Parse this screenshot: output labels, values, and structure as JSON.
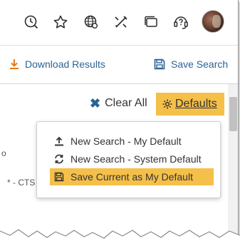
{
  "toolbar": {
    "icons": [
      "history-icon",
      "star-icon",
      "globe-settings-icon",
      "tools-icon",
      "windows-icon",
      "help-headset-icon"
    ]
  },
  "actions": {
    "download_label": "Download Results",
    "save_search_label": "Save Search"
  },
  "filters": {
    "clear_all_label": "Clear All",
    "defaults_label": "Defaults"
  },
  "background": {
    "fragment_1": "o",
    "fragment_2": "* - CTS"
  },
  "defaults_menu": {
    "items": [
      {
        "label": "New Search - My Default",
        "icon": "upload-icon"
      },
      {
        "label": "New Search - System Default",
        "icon": "refresh-icon"
      },
      {
        "label": "Save Current as My Default",
        "icon": "floppy-icon"
      }
    ],
    "highlighted_index": 2
  },
  "colors": {
    "accent": "#f5c04a",
    "link": "#2a6496",
    "download_icon": "#e07a1f"
  }
}
